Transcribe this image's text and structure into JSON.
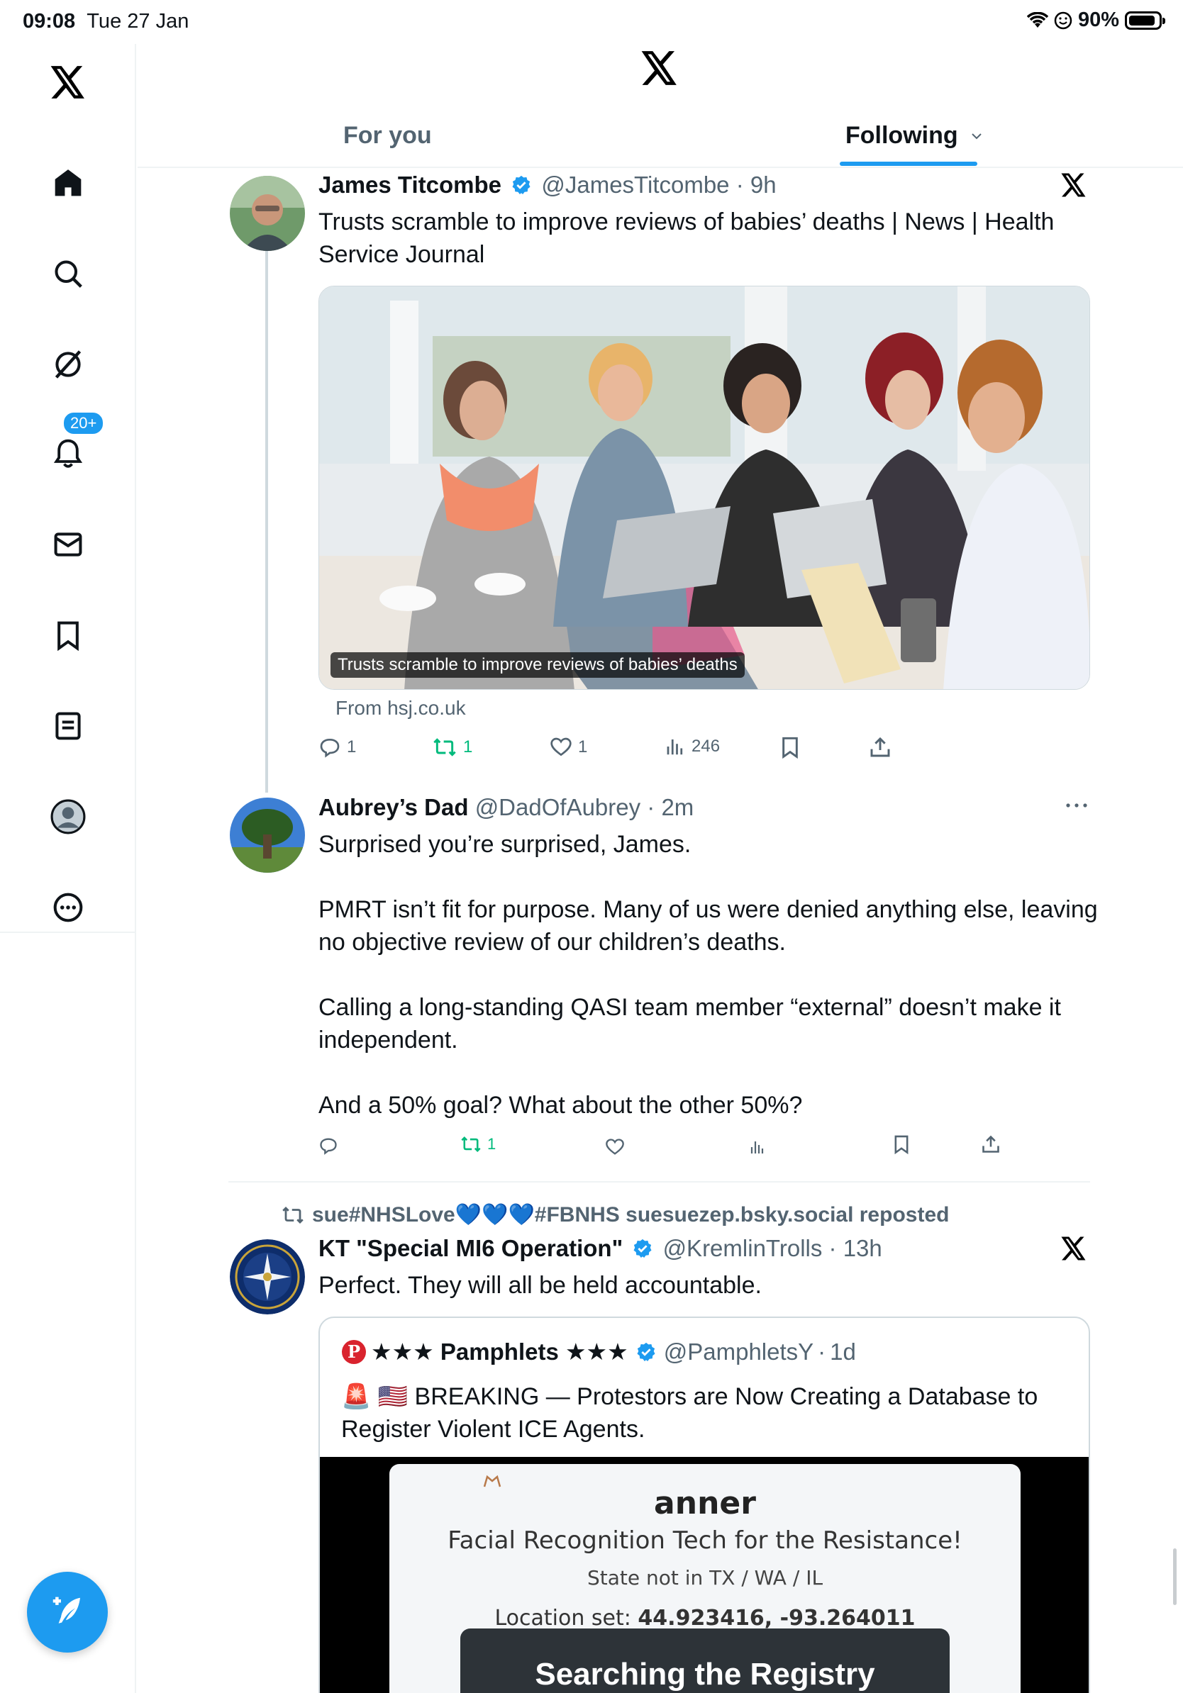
{
  "status_bar": {
    "time": "09:08",
    "date": "Tue 27 Jan",
    "battery": "90%",
    "battery_level": 0.9
  },
  "sidebar": {
    "items": [
      {
        "name": "home",
        "icon": "home-icon"
      },
      {
        "name": "explore",
        "icon": "search-icon"
      },
      {
        "name": "grok",
        "icon": "grok-icon"
      },
      {
        "name": "notifications",
        "icon": "bell-icon",
        "badge": "20+"
      },
      {
        "name": "messages",
        "icon": "envelope-icon"
      },
      {
        "name": "bookmarks",
        "icon": "bookmark-icon"
      },
      {
        "name": "lists",
        "icon": "list-icon"
      },
      {
        "name": "profile",
        "icon": "profile-icon"
      },
      {
        "name": "more",
        "icon": "more-icon"
      }
    ],
    "notifications_badge": "20+",
    "compose_icon": "compose-icon"
  },
  "header": {
    "tabs": [
      "For you",
      "Following"
    ],
    "active_tab": "Following"
  },
  "tweets": [
    {
      "name": "James Titcombe",
      "handle": "@JamesTitcombe",
      "time": "9h",
      "text": "Trusts scramble to improve reviews of babies’ deaths | News | Health Service Journal",
      "card_caption": "Trusts scramble to improve reviews of babies’ deaths",
      "card_source": "From hsj.co.uk",
      "replies": "1",
      "reposts": "1",
      "likes": "1",
      "views": "246"
    },
    {
      "name": "Aubrey’s Dad",
      "handle": "@DadOfAubrey",
      "time": "2m",
      "paragraphs": [
        "Surprised you’re surprised, James.",
        "PMRT isn’t fit for purpose. Many of us were denied anything else, leaving no objective review of our children’s deaths.",
        "Calling a long-standing QASI team member “external” doesn’t make it independent.",
        "And a 50% goal? What about the other 50%?"
      ],
      "reposts": "1"
    },
    {
      "repost_by": "sue#NHSLove💙💙💙#FBNHS suesuezep.bsky.social reposted",
      "name": "KT \"Special MI6 Operation\"",
      "handle": "@KremlinTrolls",
      "time": "13h",
      "text": "Perfect. They will all be held accountable.",
      "quote": {
        "name": "★★★ Pamphlets ★★★",
        "handle": "@PamphletsY",
        "time": "1d",
        "text": "🚨 🇺🇸 BREAKING — Protestors are Now Creating a Database to Register Violent ICE Agents.",
        "video_lines": {
          "title": "anner",
          "subtitle": "Facial Recognition Tech for the Resistance!",
          "state": "State not in TX / WA / IL",
          "location_label": "Location set:",
          "location_value": "44.923416, -93.264011",
          "button": "Searching the Registry"
        }
      }
    }
  ],
  "colors": {
    "accent": "#1d9bf0",
    "repost_green": "#00ba7c",
    "muted": "#536471",
    "text": "#0f1419",
    "border": "#eff3f4"
  }
}
